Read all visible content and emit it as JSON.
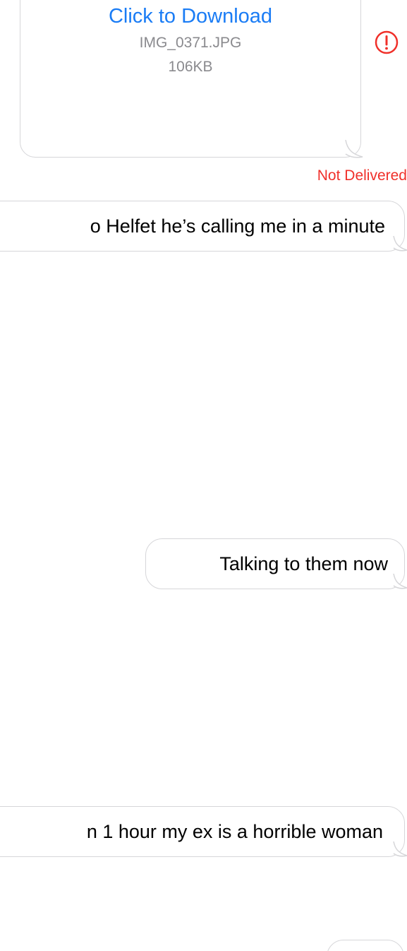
{
  "attachment": {
    "download_label": "Click to Download",
    "file_name": "IMG_0371.JPG",
    "file_size": "106KB",
    "status_icon": "exclamation-circle-icon",
    "status_color": "#f0302a",
    "link_color": "#1a7cf5"
  },
  "delivery": {
    "status_text": "Not Delivered"
  },
  "messages": [
    {
      "text": "o Helfet he’s calling me in a minute"
    },
    {
      "text": "Talking to them now"
    },
    {
      "text": "n 1 hour my ex is a horrible woman"
    },
    {
      "text": ""
    }
  ]
}
